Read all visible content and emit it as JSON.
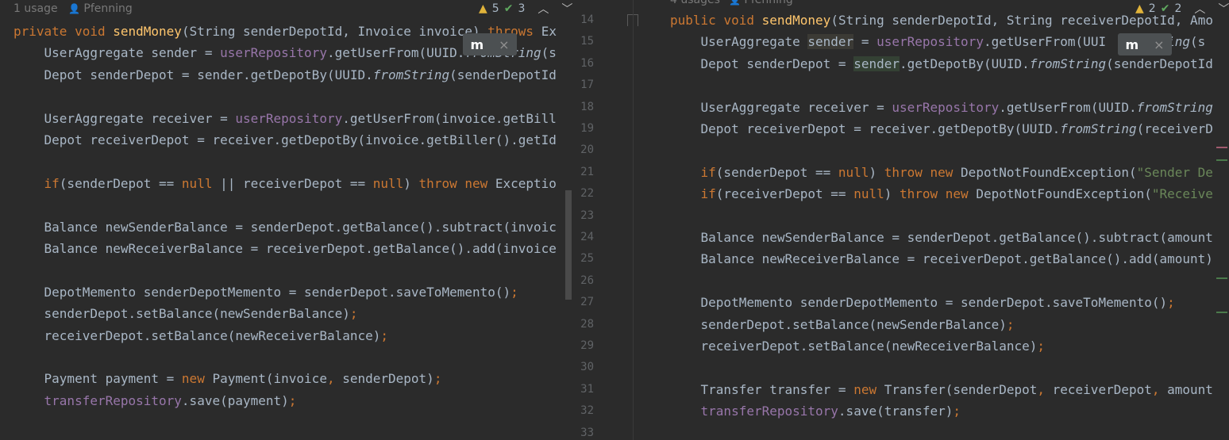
{
  "left": {
    "usages": "1 usage",
    "author": "Pfenning",
    "warnings": "5",
    "checks": "3",
    "lines": [
      {
        "segs": [
          [
            "private ",
            "kw"
          ],
          [
            "void ",
            "kw"
          ],
          [
            "sendMoney",
            "fn"
          ],
          [
            "(String senderDepotId, Invoice invoice) ",
            ""
          ],
          [
            "throws ",
            "kw"
          ],
          [
            "Ex",
            ""
          ]
        ]
      },
      {
        "segs": [
          [
            "    UserAggregate sender = ",
            ""
          ],
          [
            "userRepository",
            "fld"
          ],
          [
            ".getUserFrom(UUID.",
            ""
          ],
          [
            "fromString",
            "it"
          ],
          [
            "(s",
            ""
          ]
        ]
      },
      {
        "segs": [
          [
            "    Depot senderDepot = sender.getDepotBy(UUID.",
            ""
          ],
          [
            "fromString",
            "it"
          ],
          [
            "(senderDepotId",
            ""
          ]
        ]
      },
      {
        "segs": [
          [
            "",
            ""
          ]
        ]
      },
      {
        "segs": [
          [
            "    UserAggregate receiver = ",
            ""
          ],
          [
            "userRepository",
            "fld"
          ],
          [
            ".getUserFrom(invoice.getBill",
            ""
          ]
        ]
      },
      {
        "segs": [
          [
            "    Depot receiverDepot = receiver.getDepotBy(invoice.getBiller().getId",
            ""
          ]
        ]
      },
      {
        "segs": [
          [
            "",
            ""
          ]
        ]
      },
      {
        "segs": [
          [
            "    ",
            ""
          ],
          [
            "if",
            "kw"
          ],
          [
            "(senderDepot == ",
            ""
          ],
          [
            "null",
            "kw"
          ],
          [
            " || receiverDepot == ",
            ""
          ],
          [
            "null",
            "kw"
          ],
          [
            ") ",
            ""
          ],
          [
            "throw ",
            "kw"
          ],
          [
            "new ",
            "kw"
          ],
          [
            "Exceptio",
            ""
          ]
        ]
      },
      {
        "segs": [
          [
            "",
            ""
          ]
        ]
      },
      {
        "segs": [
          [
            "    Balance newSenderBalance = senderDepot.getBalance().subtract(invoic",
            ""
          ]
        ]
      },
      {
        "segs": [
          [
            "    Balance newReceiverBalance = receiverDepot.getBalance().add(invoice",
            ""
          ]
        ]
      },
      {
        "segs": [
          [
            "",
            ""
          ]
        ]
      },
      {
        "segs": [
          [
            "    DepotMemento senderDepotMemento = senderDepot.saveToMemento()",
            ""
          ],
          [
            ";",
            "kw"
          ]
        ]
      },
      {
        "segs": [
          [
            "    senderDepot.setBalance(newSenderBalance)",
            ""
          ],
          [
            ";",
            "kw"
          ]
        ]
      },
      {
        "segs": [
          [
            "    receiverDepot.setBalance(newReceiverBalance)",
            ""
          ],
          [
            ";",
            "kw"
          ]
        ]
      },
      {
        "segs": [
          [
            "",
            ""
          ]
        ]
      },
      {
        "segs": [
          [
            "    Payment payment = ",
            ""
          ],
          [
            "new ",
            "kw"
          ],
          [
            "Payment(invoice",
            ""
          ],
          [
            ", ",
            "kw"
          ],
          [
            "senderDepot)",
            ""
          ],
          [
            ";",
            "kw"
          ]
        ]
      },
      {
        "segs": [
          [
            "    ",
            ""
          ],
          [
            "transferRepository",
            "fld"
          ],
          [
            ".save(payment)",
            ""
          ],
          [
            ";",
            "kw"
          ]
        ]
      }
    ]
  },
  "right": {
    "usages": "4 usages",
    "author": "Pfenning",
    "warnings": "2",
    "checks": "2",
    "line_numbers": [
      "14",
      "15",
      "16",
      "17",
      "18",
      "19",
      "20",
      "21",
      "22",
      "23",
      "24",
      "25",
      "26",
      "27",
      "28",
      "29",
      "30",
      "31",
      "32",
      "33"
    ],
    "lines": [
      {
        "segs": [
          [
            "public ",
            "kw"
          ],
          [
            "void ",
            "kw"
          ],
          [
            "sendMoney",
            "fn"
          ],
          [
            "(String senderDepotId, String receiverDepotId, Amo",
            ""
          ]
        ]
      },
      {
        "segs": [
          [
            "    UserAggregate ",
            ""
          ],
          [
            "sender",
            "hl"
          ],
          [
            " = ",
            ""
          ],
          [
            "userRepository",
            "fld"
          ],
          [
            ".getUserFrom(UUI",
            ""
          ],
          [
            "     String",
            "it"
          ],
          [
            "(s",
            ""
          ]
        ]
      },
      {
        "segs": [
          [
            "    Depot senderDepot = ",
            ""
          ],
          [
            "sender",
            "hl2"
          ],
          [
            ".getDepotBy(UUID.",
            ""
          ],
          [
            "fromString",
            "it"
          ],
          [
            "(senderDepotId",
            ""
          ]
        ]
      },
      {
        "segs": [
          [
            "",
            ""
          ]
        ]
      },
      {
        "segs": [
          [
            "    UserAggregate receiver = ",
            ""
          ],
          [
            "userRepository",
            "fld"
          ],
          [
            ".getUserFrom(UUID.",
            ""
          ],
          [
            "fromString",
            "it"
          ]
        ]
      },
      {
        "segs": [
          [
            "    Depot receiverDepot = receiver.getDepotBy(UUID.",
            ""
          ],
          [
            "fromString",
            "it"
          ],
          [
            "(receiverD",
            ""
          ]
        ]
      },
      {
        "segs": [
          [
            "",
            ""
          ]
        ]
      },
      {
        "segs": [
          [
            "    ",
            ""
          ],
          [
            "if",
            "kw"
          ],
          [
            "(senderDepot == ",
            ""
          ],
          [
            "null",
            "kw"
          ],
          [
            ") ",
            ""
          ],
          [
            "throw ",
            "kw"
          ],
          [
            "new ",
            "kw"
          ],
          [
            "DepotNotFoundException(",
            ""
          ],
          [
            "\"Sender De",
            "str"
          ]
        ]
      },
      {
        "segs": [
          [
            "    ",
            ""
          ],
          [
            "if",
            "kw"
          ],
          [
            "(receiverDepot == ",
            ""
          ],
          [
            "null",
            "kw"
          ],
          [
            ") ",
            ""
          ],
          [
            "throw ",
            "kw"
          ],
          [
            "new ",
            "kw"
          ],
          [
            "DepotNotFoundException(",
            ""
          ],
          [
            "\"Receive",
            "str"
          ]
        ]
      },
      {
        "segs": [
          [
            "",
            ""
          ]
        ]
      },
      {
        "segs": [
          [
            "    Balance newSenderBalance = senderDepot.getBalance().subtract(amount",
            ""
          ]
        ]
      },
      {
        "segs": [
          [
            "    Balance newReceiverBalance = receiverDepot.getBalance().add(amount)",
            ""
          ]
        ]
      },
      {
        "segs": [
          [
            "",
            ""
          ]
        ]
      },
      {
        "segs": [
          [
            "    DepotMemento senderDepotMemento = senderDepot.saveToMemento()",
            ""
          ],
          [
            ";",
            "kw"
          ]
        ]
      },
      {
        "segs": [
          [
            "    senderDepot.setBalance(newSenderBalance)",
            ""
          ],
          [
            ";",
            "kw"
          ]
        ]
      },
      {
        "segs": [
          [
            "    receiverDepot.setBalance(newReceiverBalance)",
            ""
          ],
          [
            ";",
            "kw"
          ]
        ]
      },
      {
        "segs": [
          [
            "",
            ""
          ]
        ]
      },
      {
        "segs": [
          [
            "    Transfer transfer = ",
            ""
          ],
          [
            "new ",
            "kw"
          ],
          [
            "Transfer(senderDepot",
            ""
          ],
          [
            ", ",
            "kw"
          ],
          [
            "receiverDepot",
            ""
          ],
          [
            ", ",
            "kw"
          ],
          [
            "amount",
            ""
          ]
        ]
      },
      {
        "segs": [
          [
            "    ",
            ""
          ],
          [
            "transferRepository",
            "fld"
          ],
          [
            ".save(transfer)",
            ""
          ],
          [
            ";",
            "kw"
          ]
        ]
      },
      {
        "segs": [
          [
            "",
            ""
          ]
        ]
      }
    ]
  },
  "popup": {
    "logo": "m",
    "close": "×"
  },
  "colors": {
    "background": "#2b2b2b",
    "keyword": "#cc7832",
    "method": "#ffc66d",
    "field": "#9876aa",
    "string": "#6a8759",
    "text": "#a9b7c6"
  }
}
